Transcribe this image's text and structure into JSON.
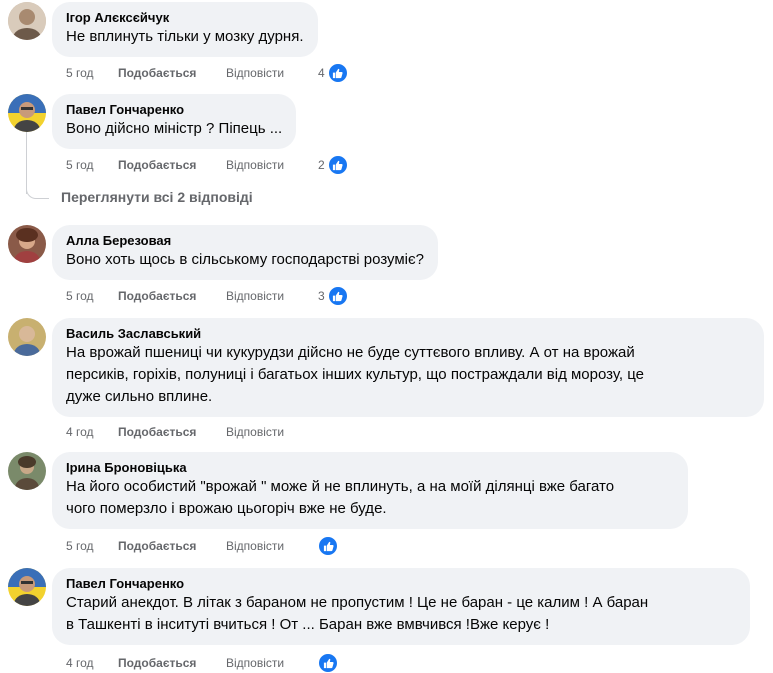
{
  "comments": [
    {
      "author": "Ігор Алєксєйчук",
      "text": "Не вплинуть тільки у мозку дурня.",
      "time": "5 год",
      "like_label": "Подобається",
      "reply_label": "Відповісти",
      "reaction_count": "4",
      "avatar_color": "#c9b8a6"
    },
    {
      "author": "Павел Гончаренко",
      "text": "Воно дійсно міністр ? Піпець ...",
      "time": "5 год",
      "like_label": "Подобається",
      "reply_label": "Відповісти",
      "reaction_count": "2",
      "avatar_color": "#3a6fb8"
    },
    {
      "author": "Алла Березовая",
      "text": "Воно хоть щось в сільському господарстві розуміє?",
      "time": "5 год",
      "like_label": "Подобається",
      "reply_label": "Відповісти",
      "reaction_count": "3",
      "avatar_color": "#7a4a3a"
    },
    {
      "author": "Василь Заславський",
      "text": "На врожай пшениці чи кукурудзи дійсно не буде суттєвого впливу. А от на врожай\nперсиків, горіхів, полуниці і багатьох інших культур, що постраждали від морозу, це\nдуже сильно вплине.",
      "time": "4 год",
      "like_label": "Подобається",
      "reply_label": "Відповісти",
      "reaction_count": "",
      "avatar_color": "#8a6a4a"
    },
    {
      "author": "Ірина Броновіцька",
      "text": "На його особистий \"врожай \" може й не вплинуть, а на моїй ділянці вже багато\nчого померзло і врожаю цьогоріч вже не буде.",
      "time": "5 год",
      "like_label": "Подобається",
      "reply_label": "Відповісти",
      "reaction_count": "",
      "avatar_color": "#6a7a5a"
    },
    {
      "author": "Павел Гончаренко",
      "text": "Старий анекдот. В літак з бараном не пропустим ! Це не баран - це калим ! А баран\nв Ташкенті в інситуті вчиться ! От ... Баран вже вмвчився !Вже керує !",
      "time": "4 год",
      "like_label": "Подобається",
      "reply_label": "Відповісти",
      "reaction_count": "",
      "avatar_color": "#3a6fb8"
    }
  ],
  "view_replies": "Переглянути всі 2 відповіді",
  "colors": {
    "bubble": "#f0f2f5",
    "meta_text": "#65676b",
    "like_blue": "#1877f2"
  },
  "icons": {
    "reaction": "thumbs-up-icon"
  }
}
